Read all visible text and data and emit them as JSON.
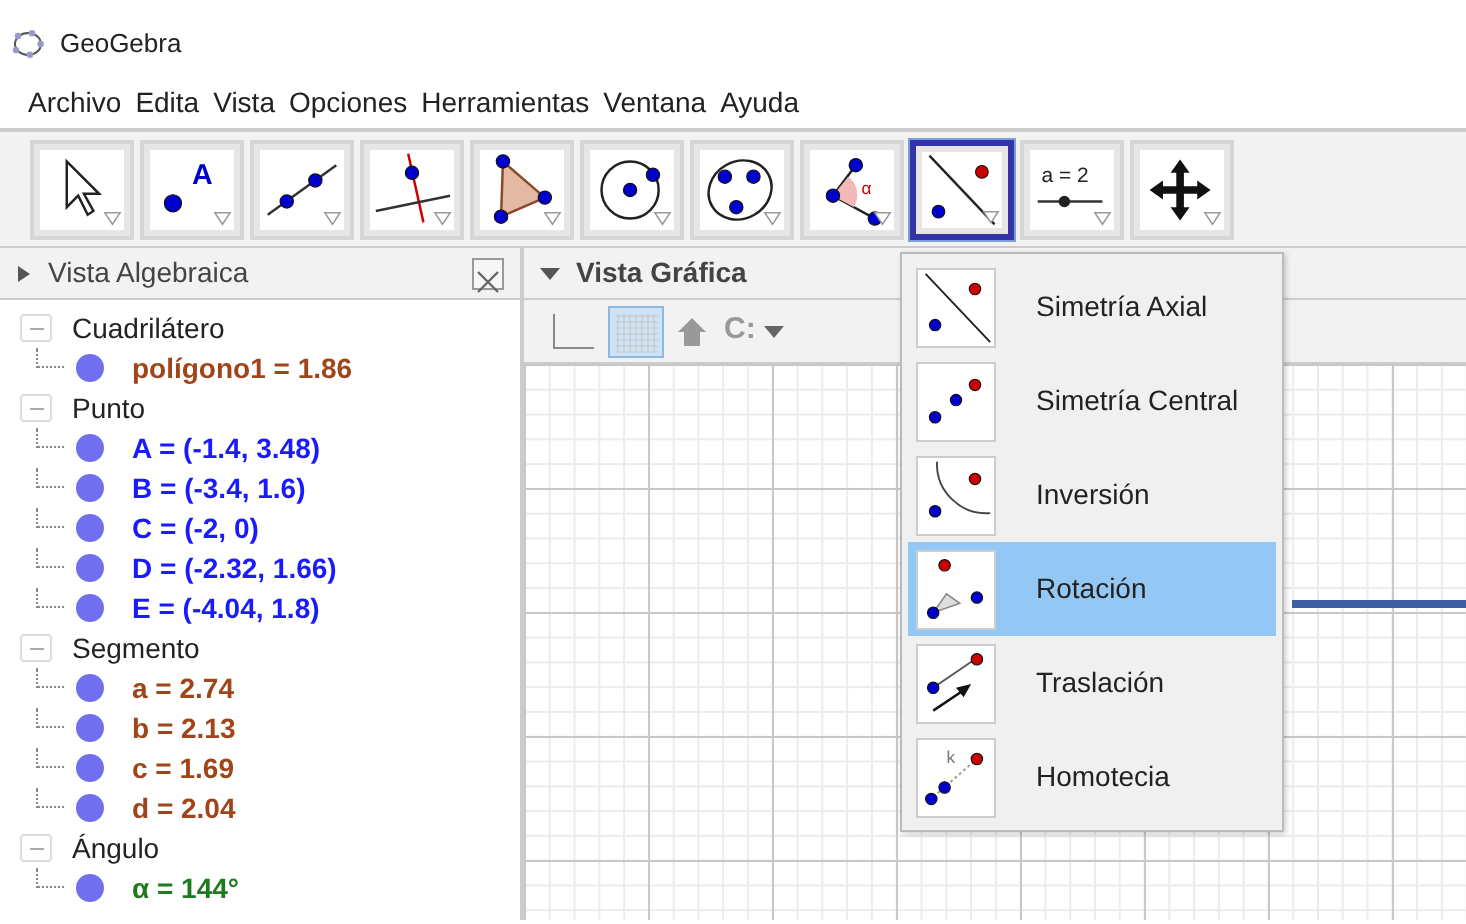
{
  "window": {
    "title": "GeoGebra"
  },
  "menu_bar": [
    "Archivo",
    "Edita",
    "Vista",
    "Opciones",
    "Herramientas",
    "Ventana",
    "Ayuda"
  ],
  "toolbar": [
    {
      "kind": "move",
      "selected": false
    },
    {
      "kind": "point",
      "selected": false,
      "icon_text": "A"
    },
    {
      "kind": "line",
      "selected": false
    },
    {
      "kind": "perpendicular",
      "selected": false
    },
    {
      "kind": "polygon",
      "selected": false
    },
    {
      "kind": "circle",
      "selected": false
    },
    {
      "kind": "conic",
      "selected": false
    },
    {
      "kind": "angle",
      "selected": false,
      "icon_text": "α"
    },
    {
      "kind": "reflect",
      "selected": true
    },
    {
      "kind": "slider",
      "selected": false,
      "icon_text": "a = 2"
    },
    {
      "kind": "move_view",
      "selected": false
    }
  ],
  "algebra_view": {
    "title": "Vista Algebraica",
    "groups": [
      {
        "label": "Cuadrilátero",
        "expanded": true,
        "children": [
          {
            "text": "polígono1 = 1.86",
            "color": "#a0451a"
          }
        ]
      },
      {
        "label": "Punto",
        "expanded": true,
        "children": [
          {
            "text": "A = (-1.4, 3.48)",
            "color": "#1a1aff"
          },
          {
            "text": "B = (-3.4, 1.6)",
            "color": "#1a1aff"
          },
          {
            "text": "C = (-2, 0)",
            "color": "#1a1aff"
          },
          {
            "text": "D = (-2.32, 1.66)",
            "color": "#1a1aff"
          },
          {
            "text": "E = (-4.04, 1.8)",
            "color": "#1a1aff"
          }
        ]
      },
      {
        "label": "Segmento",
        "expanded": true,
        "children": [
          {
            "text": "a = 2.74",
            "color": "#a0451a"
          },
          {
            "text": "b = 2.13",
            "color": "#a0451a"
          },
          {
            "text": "c = 1.69",
            "color": "#a0451a"
          },
          {
            "text": "d = 2.04",
            "color": "#a0451a"
          }
        ]
      },
      {
        "label": "Ángulo",
        "expanded": true,
        "children": [
          {
            "text": "α = 144°",
            "color": "#1e7a1e"
          }
        ]
      }
    ]
  },
  "graphics_view": {
    "title": "Vista Gráfica",
    "grid_on": true,
    "capture_label": "C:"
  },
  "tool_menu": [
    {
      "kind": "reflect_line",
      "label": "Simetría Axial",
      "selected": false
    },
    {
      "kind": "reflect_point",
      "label": "Simetría Central",
      "selected": false
    },
    {
      "kind": "invert",
      "label": "Inversión",
      "selected": false
    },
    {
      "kind": "rotate",
      "label": "Rotación",
      "selected": true
    },
    {
      "kind": "translate",
      "label": "Traslación",
      "selected": false
    },
    {
      "kind": "dilate",
      "label": "Homotecia",
      "selected": false,
      "icon_text": "k"
    }
  ]
}
